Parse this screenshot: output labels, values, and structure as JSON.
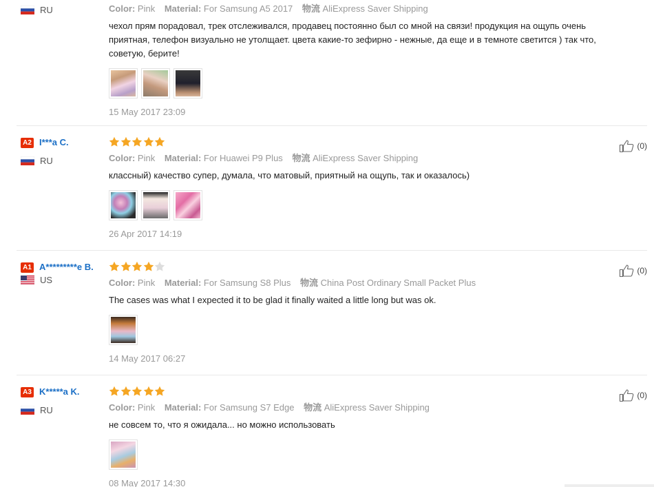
{
  "labels": {
    "color": "Color:",
    "material": "Material:",
    "shipping_icon": "物流"
  },
  "reviews": [
    {
      "name": "",
      "level": "",
      "country": "RU",
      "stars": 0,
      "color": "Pink",
      "material": "For Samsung A5 2017",
      "shipping": "AliExpress Saver Shipping",
      "text": "чехол прям порадовал, трек отслеживался, продавец постоянно был со мной на связи! продукция на ощупь очень приятная, телефон визуально не утолщает. цвета какие-то зефирно - нежные, да еще и в темноте светится ) так что, советую, берите!",
      "photos": 3,
      "date": "15 May 2017 23:09",
      "likes": ""
    },
    {
      "name": "I***a C.",
      "level": "A2",
      "country": "RU",
      "stars": 5,
      "color": "Pink",
      "material": "For Huawei P9 Plus",
      "shipping": "AliExpress Saver Shipping",
      "text": "классный) качество супер, думала, что матовый, приятный на ощупь, так и оказалось)",
      "photos": 3,
      "date": "26 Apr 2017 14:19",
      "likes": "(0)"
    },
    {
      "name": "A*********e B.",
      "level": "A1",
      "country": "US",
      "stars": 4,
      "color": "Pink",
      "material": "For Samsung S8 Plus",
      "shipping": "China Post Ordinary Small Packet Plus",
      "text": "The cases was what I expected it to be glad it finally waited a little long but was ok.",
      "photos": 1,
      "date": "14 May 2017 06:27",
      "likes": "(0)"
    },
    {
      "name": "K*****a K.",
      "level": "A3",
      "country": "RU",
      "stars": 5,
      "color": "Pink",
      "material": "For Samsung S7 Edge",
      "shipping": "AliExpress Saver Shipping",
      "text": "не совсем то, что я ожидала... но можно использовать",
      "photos": 1,
      "date": "08 May 2017 14:30",
      "likes": "(0)"
    }
  ],
  "colors": {
    "star": "#f5a623",
    "star_empty": "#dddddd",
    "name": "#1b6fc6",
    "badge": "#e62e04"
  },
  "icons": {
    "like": "thumbs-up-icon",
    "star": "star-icon",
    "flag_ru": "flag-ru-icon",
    "flag_us": "flag-us-icon"
  }
}
